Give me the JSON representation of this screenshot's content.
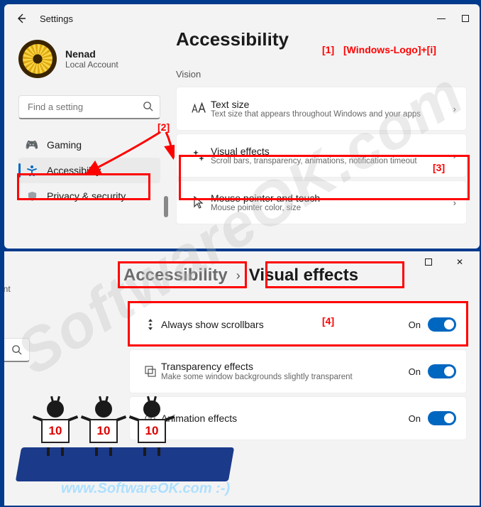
{
  "window1": {
    "title": "Settings",
    "page_title": "Accessibility",
    "profile": {
      "name": "Nenad",
      "sub": "Local Account"
    },
    "search_placeholder": "Find a setting",
    "nav": {
      "gaming": "Gaming",
      "accessibility": "Accessibility",
      "privacy": "Privacy & security"
    },
    "section_label": "Vision",
    "cards": {
      "text_size": {
        "title": "Text size",
        "sub": "Text size that appears throughout Windows and your apps"
      },
      "visual_effects": {
        "title": "Visual effects",
        "sub": "Scroll bars, transparency, animations, notification timeout"
      },
      "mouse": {
        "title": "Mouse pointer and touch",
        "sub": "Mouse pointer color, size"
      }
    }
  },
  "window2": {
    "sidebar_hint": "unt",
    "breadcrumb": {
      "part1": "Accessibility",
      "part2": "Visual effects"
    },
    "rows": {
      "scrollbars": {
        "title": "Always show scrollbars",
        "value": "On"
      },
      "transparency": {
        "title": "Transparency effects",
        "sub": "Make some window backgrounds slightly transparent",
        "value": "On"
      },
      "animation": {
        "title": "Animation effects",
        "value": "On"
      }
    }
  },
  "annotations": {
    "a1_label": "[1]",
    "a1_text": "[Windows-Logo]+[i]",
    "a2": "[2]",
    "a3": "[3]",
    "a4": "[4]"
  },
  "mascot_number": "10",
  "banner": "www.SoftwareOK.com :-)",
  "watermark": "SoftwareOK.com"
}
